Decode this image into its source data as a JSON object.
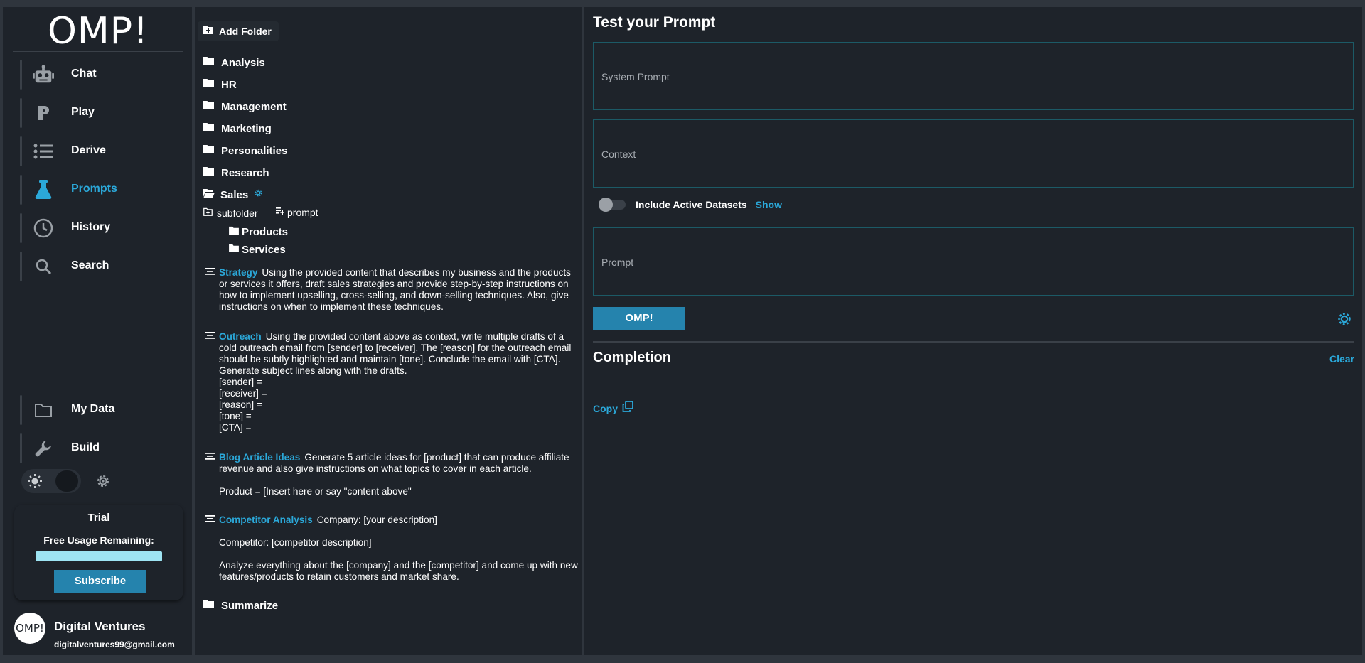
{
  "brand": {
    "logo_text": "OMP!"
  },
  "nav": {
    "items": [
      {
        "label": "Chat",
        "icon": "robot-icon"
      },
      {
        "label": "Play",
        "icon": "play-p-icon"
      },
      {
        "label": "Derive",
        "icon": "list-icon"
      },
      {
        "label": "Prompts",
        "icon": "flask-icon",
        "active": true
      },
      {
        "label": "History",
        "icon": "clock-icon"
      },
      {
        "label": "Search",
        "icon": "search-icon"
      }
    ],
    "bottom_items": [
      {
        "label": "My Data",
        "icon": "folder-icon"
      },
      {
        "label": "Build",
        "icon": "wrench-icon"
      }
    ]
  },
  "trial": {
    "title": "Trial",
    "usage_label": "Free Usage Remaining:",
    "usage_fraction": 1.0,
    "subscribe_label": "Subscribe"
  },
  "user": {
    "avatar_text": "OMP!",
    "name": "Digital Ventures",
    "email": "digitalventures99@gmail.com"
  },
  "folders": {
    "add_folder_label": "Add Folder",
    "top": [
      "Analysis",
      "HR",
      "Management",
      "Marketing",
      "Personalities",
      "Research"
    ],
    "open_folder": "Sales",
    "subfolder_action": "subfolder",
    "prompt_action": "prompt",
    "subfolders": [
      "Products",
      "Services"
    ],
    "prompts": [
      {
        "title": "Strategy",
        "text": "Using the provided content that describes my business and the products or services it offers, draft sales strategies and provide step-by-step instructions on how to implement upselling, cross-selling, and down-selling techniques. Also, give instructions on when to implement these techniques."
      },
      {
        "title": "Outreach",
        "text": "Using the provided content above as context, write multiple drafts of a cold outreach email from [sender] to [receiver]. The [reason] for the outreach email should be subtly highlighted and maintain [tone]. Conclude the email with [CTA]. Generate subject lines along with the drafts.\n[sender] =\n[receiver] =\n[reason] =\n[tone] =\n[CTA] ="
      },
      {
        "title": "Blog Article Ideas",
        "text": "Generate 5 article ideas for [product] that can produce affiliate revenue and also give instructions on what topics to cover in each article.\n\nProduct = [Insert here or say \"content above\""
      },
      {
        "title": "Competitor Analysis",
        "text": "Company: [your description]\n\nCompetitor: [competitor description]\n\nAnalyze everything about the [company] and the [competitor] and come up with new features/products to retain customers and market share."
      }
    ],
    "after": [
      "Summarize"
    ]
  },
  "test": {
    "title": "Test your Prompt",
    "system_prompt_placeholder": "System Prompt",
    "context_placeholder": "Context",
    "include_label": "Include Active Datasets",
    "show_label": "Show",
    "prompt_placeholder": "Prompt",
    "run_label": "OMP!",
    "completion_title": "Completion",
    "clear_label": "Clear",
    "copy_label": "Copy"
  },
  "colors": {
    "accent": "#2ba8d9",
    "panel": "#1e232a",
    "background": "#2f353d",
    "button": "#2583ad",
    "field_border": "#1c5a66"
  }
}
